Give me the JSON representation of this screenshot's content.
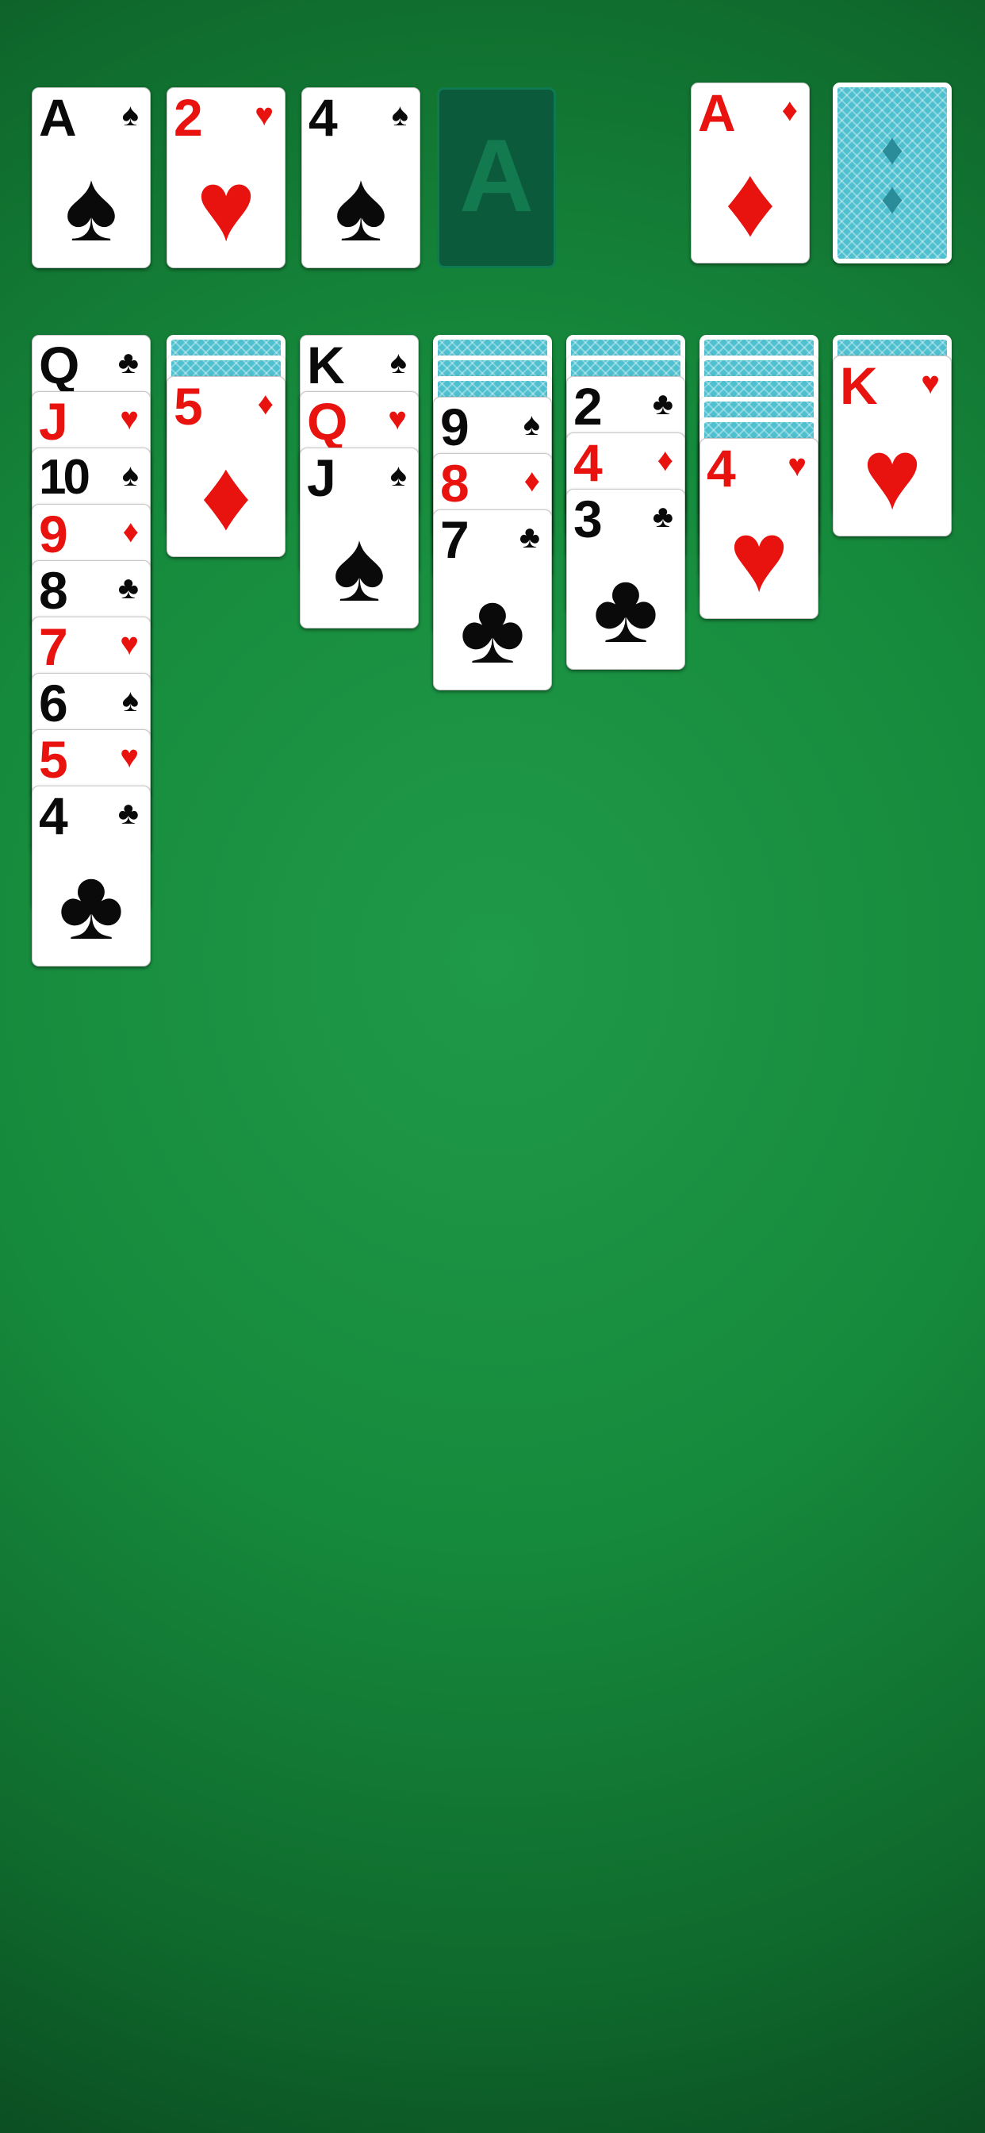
{
  "table": {
    "felt_color": "#168a3c"
  },
  "foundations": [
    {
      "rank": "A",
      "suit": "♠",
      "color": "black"
    },
    {
      "rank": "2",
      "suit": "♥",
      "color": "red"
    },
    {
      "rank": "4",
      "suit": "♠",
      "color": "black"
    },
    {
      "empty": true,
      "placeholder": "A"
    }
  ],
  "waste": {
    "rank": "A",
    "suit": "♦",
    "color": "red"
  },
  "stock": {
    "face_down": true,
    "emblem": "♦"
  },
  "tableau": [
    {
      "hidden": 0,
      "cards": [
        {
          "rank": "Q",
          "suit": "♣",
          "color": "black"
        },
        {
          "rank": "J",
          "suit": "♥",
          "color": "red"
        },
        {
          "rank": "10",
          "suit": "♠",
          "color": "black"
        },
        {
          "rank": "9",
          "suit": "♦",
          "color": "red"
        },
        {
          "rank": "8",
          "suit": "♣",
          "color": "black"
        },
        {
          "rank": "7",
          "suit": "♥",
          "color": "red"
        },
        {
          "rank": "6",
          "suit": "♠",
          "color": "black"
        },
        {
          "rank": "5",
          "suit": "♥",
          "color": "red"
        },
        {
          "rank": "4",
          "suit": "♣",
          "color": "black"
        }
      ]
    },
    {
      "hidden": 2,
      "cards": [
        {
          "rank": "5",
          "suit": "♦",
          "color": "red"
        }
      ]
    },
    {
      "hidden": 0,
      "cards": [
        {
          "rank": "K",
          "suit": "♠",
          "color": "black"
        },
        {
          "rank": "Q",
          "suit": "♥",
          "color": "red"
        },
        {
          "rank": "J",
          "suit": "♠",
          "color": "black"
        }
      ]
    },
    {
      "hidden": 3,
      "cards": [
        {
          "rank": "9",
          "suit": "♠",
          "color": "black"
        },
        {
          "rank": "8",
          "suit": "♦",
          "color": "red"
        },
        {
          "rank": "7",
          "suit": "♣",
          "color": "black"
        }
      ]
    },
    {
      "hidden": 2,
      "cards": [
        {
          "rank": "2",
          "suit": "♣",
          "color": "black"
        },
        {
          "rank": "4",
          "suit": "♦",
          "color": "red"
        },
        {
          "rank": "3",
          "suit": "♣",
          "color": "black"
        }
      ]
    },
    {
      "hidden": 5,
      "cards": [
        {
          "rank": "4",
          "suit": "♥",
          "color": "red"
        }
      ]
    },
    {
      "hidden": 1,
      "cards": [
        {
          "rank": "K",
          "suit": "♥",
          "color": "red"
        }
      ]
    }
  ]
}
